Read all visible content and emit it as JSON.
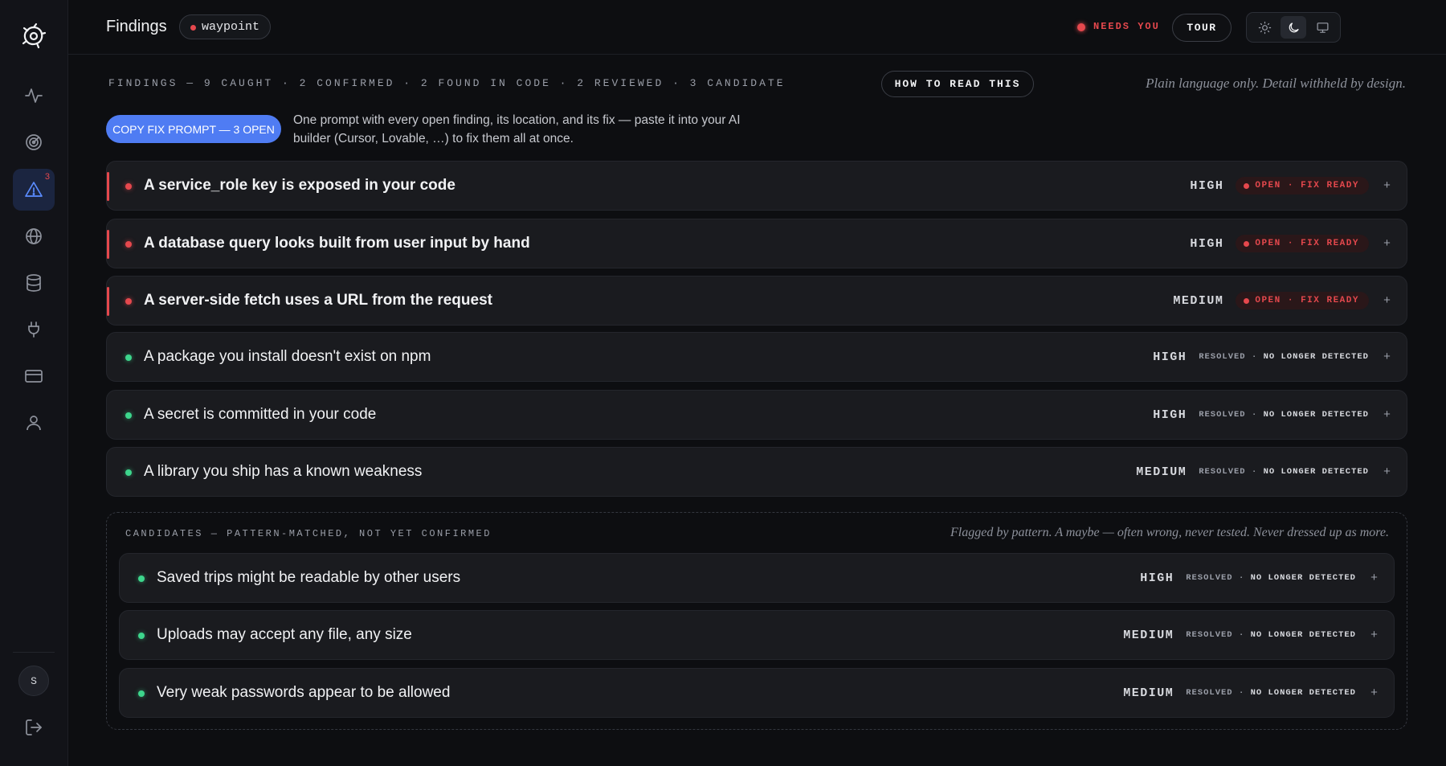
{
  "sidebar": {
    "logo": "logo-icon",
    "items": [
      {
        "name": "activity",
        "icon": "activity-icon",
        "active": false
      },
      {
        "name": "radar",
        "icon": "radar-icon",
        "active": false
      },
      {
        "name": "findings",
        "icon": "alert-triangle-icon",
        "active": true,
        "badge": "3"
      },
      {
        "name": "globe",
        "icon": "globe-icon",
        "active": false
      },
      {
        "name": "database",
        "icon": "database-icon",
        "active": false
      },
      {
        "name": "integrations",
        "icon": "plug-icon",
        "active": false
      },
      {
        "name": "billing",
        "icon": "credit-card-icon",
        "active": false
      },
      {
        "name": "account",
        "icon": "user-icon",
        "active": false
      }
    ],
    "avatar_initial": "S",
    "logout_icon": "logout-icon"
  },
  "header": {
    "title": "Findings",
    "project": "waypoint",
    "needs_you": "NEEDS YOU",
    "tour": "TOUR",
    "theme_options": [
      "sun-icon",
      "moon-icon",
      "monitor-icon"
    ],
    "active_theme": "moon-icon"
  },
  "summary": {
    "line": "FINDINGS — 9 CAUGHT · 2 CONFIRMED · 2 FOUND IN CODE · 2 REVIEWED · 3 CANDIDATE",
    "how_to_read": "HOW TO READ THIS",
    "note": "Plain language only. Detail withheld by design."
  },
  "copy_prompt": {
    "button": "COPY FIX PROMPT — 3 OPEN",
    "description": "One prompt with every open finding, its location, and its fix — paste it into your AI builder (Cursor, Lovable, …) to fix them all at once."
  },
  "findings": [
    {
      "title": "A service_role key is exposed in your code",
      "severity": "HIGH",
      "status": "OPEN · FIX READY",
      "open": true
    },
    {
      "title": "A database query looks built from user input by hand",
      "severity": "HIGH",
      "status": "OPEN · FIX READY",
      "open": true
    },
    {
      "title": "A server-side fetch uses a URL from the request",
      "severity": "MEDIUM",
      "status": "OPEN · FIX READY",
      "open": true
    },
    {
      "title": "A package you install doesn't exist on npm",
      "severity": "HIGH",
      "status_a": "RESOLVED",
      "status_b": "NO LONGER DETECTED",
      "open": false
    },
    {
      "title": "A secret is committed in your code",
      "severity": "HIGH",
      "status_a": "RESOLVED",
      "status_b": "NO LONGER DETECTED",
      "open": false
    },
    {
      "title": "A library you ship has a known weakness",
      "severity": "MEDIUM",
      "status_a": "RESOLVED",
      "status_b": "NO LONGER DETECTED",
      "open": false
    }
  ],
  "candidates": {
    "label": "CANDIDATES — PATTERN-MATCHED, NOT YET CONFIRMED",
    "note": "Flagged by pattern. A maybe — often wrong, never tested. Never dressed up as more.",
    "items": [
      {
        "title": "Saved trips might be readable by other users",
        "severity": "HIGH",
        "status_a": "RESOLVED",
        "status_b": "NO LONGER DETECTED"
      },
      {
        "title": "Uploads may accept any file, any size",
        "severity": "MEDIUM",
        "status_a": "RESOLVED",
        "status_b": "NO LONGER DETECTED"
      },
      {
        "title": "Very weak passwords appear to be allowed",
        "severity": "MEDIUM",
        "status_a": "RESOLVED",
        "status_b": "NO LONGER DETECTED"
      }
    ]
  },
  "expand_symbol": "+",
  "separator": "·",
  "colors": {
    "background": "#0d0e11",
    "accent": "#4f7cf3",
    "danger": "#e5484d",
    "success": "#3dd68c"
  }
}
